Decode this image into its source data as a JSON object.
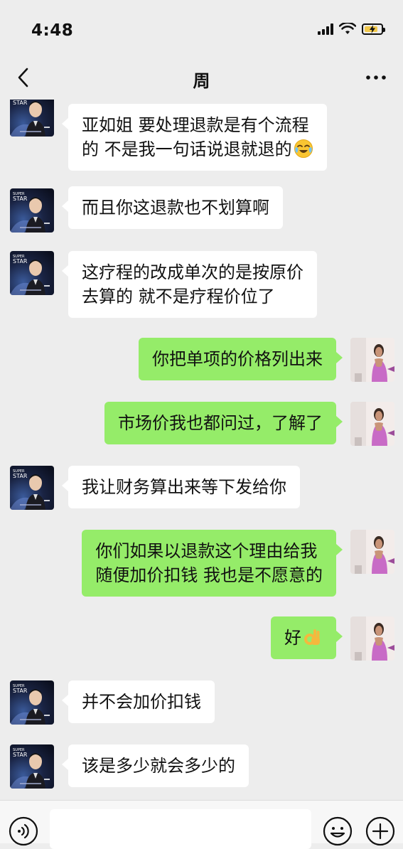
{
  "status_bar": {
    "time": "4:48"
  },
  "header": {
    "title": "周"
  },
  "avatar_left": {
    "brand_line1": "SUPER",
    "brand_line2": "STAR"
  },
  "messages": [
    {
      "side": "in",
      "lines": [
        "亚如姐 要处理退款是有个流程",
        "的 不是我一句话说退就退的"
      ],
      "emoji": "crying-laughing-emoji"
    },
    {
      "side": "in",
      "lines": [
        "而且你这退款也不划算啊"
      ]
    },
    {
      "side": "in",
      "lines": [
        "这疗程的改成单次的是按原价",
        "去算的 就不是疗程价位了"
      ]
    },
    {
      "side": "out",
      "lines": [
        "你把单项的价格列出来"
      ]
    },
    {
      "side": "out",
      "lines": [
        "市场价我也都问过，了解了"
      ]
    },
    {
      "side": "in",
      "lines": [
        "我让财务算出来等下发给你"
      ]
    },
    {
      "side": "out",
      "lines": [
        "你们如果以退款这个理由给我",
        "随便加价扣钱 我也是不愿意的"
      ]
    },
    {
      "side": "out",
      "lines": [
        "好"
      ],
      "emoji": "ok-hand-emoji"
    },
    {
      "side": "in",
      "lines": [
        "并不会加价扣钱"
      ]
    },
    {
      "side": "in",
      "lines": [
        "该是多少就会多少的"
      ]
    }
  ],
  "input": {
    "value": ""
  },
  "colors": {
    "outgoing_bubble": "#95ec69",
    "incoming_bubble": "#ffffff",
    "background": "#ededed"
  }
}
